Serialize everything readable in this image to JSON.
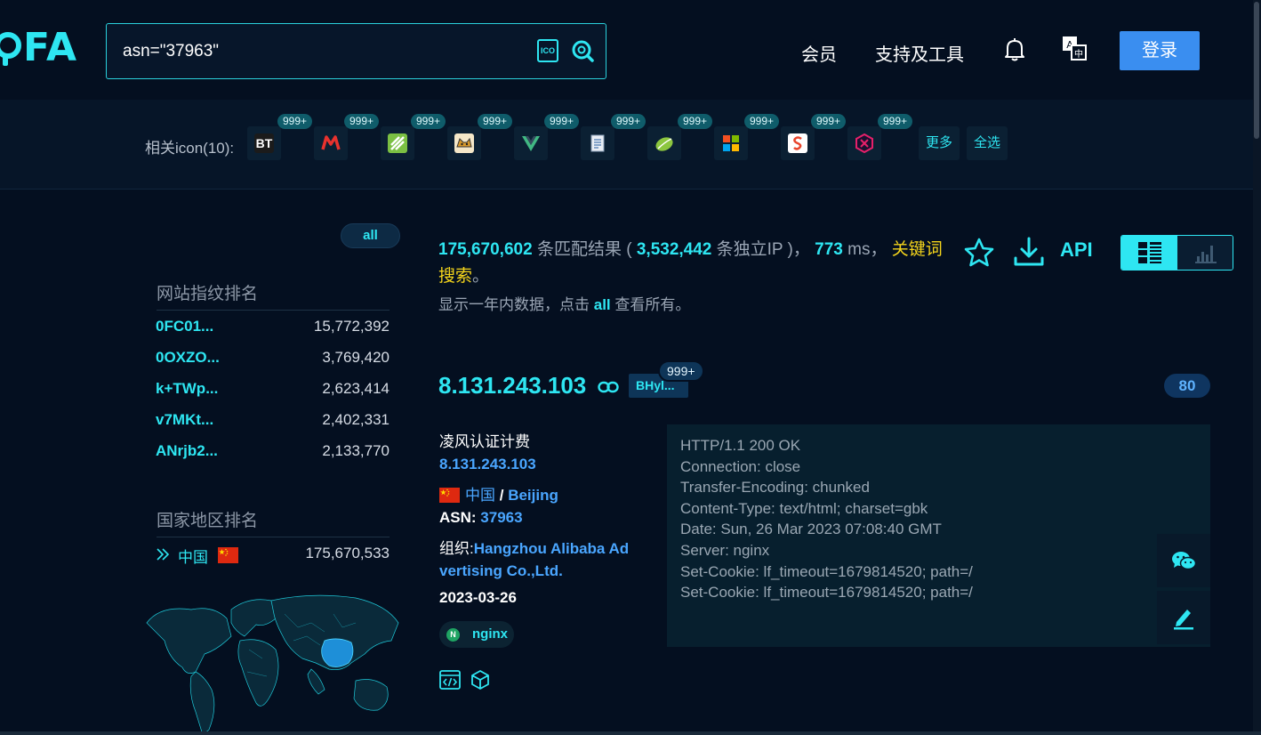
{
  "header": {
    "logo_text": "FA",
    "search_value": "asn=\"37963\"",
    "ico_label": "ICO",
    "nav": [
      "会员",
      "支持及工具"
    ],
    "login_label": "登录"
  },
  "icon_bar": {
    "label": "相关icon(10):",
    "badge": "999+",
    "first_icon_text": "BT",
    "more_label": "更多",
    "select_all_label": "全选"
  },
  "left_panel": {
    "all_label": "all",
    "fingerprint_title": "网站指纹排名",
    "fingerprints": [
      {
        "name": "0FC01...",
        "count": "15,772,392"
      },
      {
        "name": "0OXZO...",
        "count": "3,769,420"
      },
      {
        "name": "k+TWp...",
        "count": "2,623,414"
      },
      {
        "name": "v7MKt...",
        "count": "2,402,331"
      },
      {
        "name": "ANrjb2...",
        "count": "2,133,770"
      }
    ],
    "country_title": "国家地区排名",
    "country": {
      "name": "中国",
      "count": "175,670,533"
    }
  },
  "results": {
    "total": "175,670,602",
    "total_suffix": "条匹配结果 (",
    "unique_ip": "3,532,442",
    "unique_suffix": "条独立IP )，",
    "time": "773",
    "time_suffix": "ms，",
    "keyword_link": "关键词搜索",
    "period": "。",
    "hint_prefix": "显示一年内数据，点击",
    "hint_all": "all",
    "hint_suffix": "查看所有。",
    "api_label": "API"
  },
  "card": {
    "ip": "8.131.243.103",
    "tag": "BHyl...",
    "tag_badge": "999+",
    "port": "80",
    "title": "凌风认证计费",
    "ip_link": "8.131.243.103",
    "country": "中国",
    "separator": "/",
    "city": "Beijing",
    "asn_label": "ASN:",
    "asn": "37963",
    "org_label": "组织:",
    "org_line1": "Hangzhou Alibaba Ad",
    "org_line2": "vertising Co.,Ltd.",
    "date": "2023-03-26",
    "server_tag": "nginx",
    "banner": [
      "HTTP/1.1 200 OK",
      "Connection: close",
      "Transfer-Encoding: chunked",
      "Content-Type: text/html; charset=gbk",
      "Date: Sun, 26 Mar 2023 07:08:40 GMT",
      "Server: nginx",
      "Set-Cookie: lf_timeout=1679814520; path=/",
      "Set-Cookie: lf_timeout=1679814520; path=/"
    ]
  },
  "colors": {
    "accent": "#2ee6f2",
    "link_blue": "#4aa6ff",
    "keyword_yellow": "#f5d51b",
    "login_blue": "#3a8ef0",
    "background": "#040f20"
  }
}
